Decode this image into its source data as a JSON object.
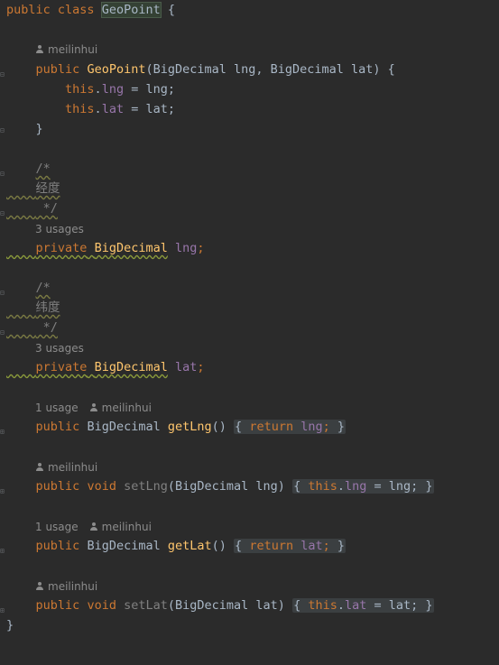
{
  "editor": {
    "language": "java",
    "author": "meilinhui",
    "class_decl": {
      "kw1": "public",
      "kw2": "class",
      "name": "GeoPoint",
      "brace": " {"
    },
    "ctor_hint": "meilinhui",
    "ctor": {
      "mods": "public",
      "name": "GeoPoint",
      "params": "(BigDecimal lng, BigDecimal lat) {"
    },
    "ctor_body_1": {
      "kw": "this",
      "field": "lng",
      "rest": " = lng;"
    },
    "ctor_body_2": {
      "kw": "this",
      "field": "lat",
      "rest": " = lat;"
    },
    "ctor_close": "}",
    "lng_comment_open": "/*",
    "lng_comment_text": "经度",
    "lng_comment_close": " */",
    "lng_usages": "3 usages",
    "lng_decl": {
      "mod": "private",
      "type": "BigDecimal",
      "name": "lng",
      "semi": ";"
    },
    "lat_comment_open": "/*",
    "lat_comment_text": "纬度",
    "lat_comment_close": " */",
    "lat_usages": "3 usages",
    "lat_decl": {
      "mod": "private",
      "type": "BigDecimal",
      "name": "lat",
      "semi": ";"
    },
    "getLng_usage": "1 usage",
    "getLng": {
      "mod": "public",
      "type": "BigDecimal",
      "name": "getLng",
      "parens": "()",
      "body_kw": "return",
      "body_field": "lng",
      "body_end": ";"
    },
    "setLng": {
      "mod": "public",
      "type": "void",
      "name": "setLng",
      "params": "(BigDecimal lng)",
      "body_kw": "this",
      "body_field": "lng",
      "body_rest": " = lng;"
    },
    "getLat_usage": "1 usage",
    "getLat": {
      "mod": "public",
      "type": "BigDecimal",
      "name": "getLat",
      "parens": "()",
      "body_kw": "return",
      "body_field": "lat",
      "body_end": ";"
    },
    "setLat": {
      "mod": "public",
      "type": "void",
      "name": "setLat",
      "params": "(BigDecimal lat)",
      "body_kw": "this",
      "body_field": "lat",
      "body_rest": " = lat;"
    },
    "class_close": "}"
  },
  "colors": {
    "background": "#2b2b2b",
    "keyword": "#cc7832",
    "method": "#ffc66d",
    "field": "#9876aa",
    "text": "#a9b7c6",
    "comment": "#808080",
    "hint": "#8c8c8c"
  }
}
